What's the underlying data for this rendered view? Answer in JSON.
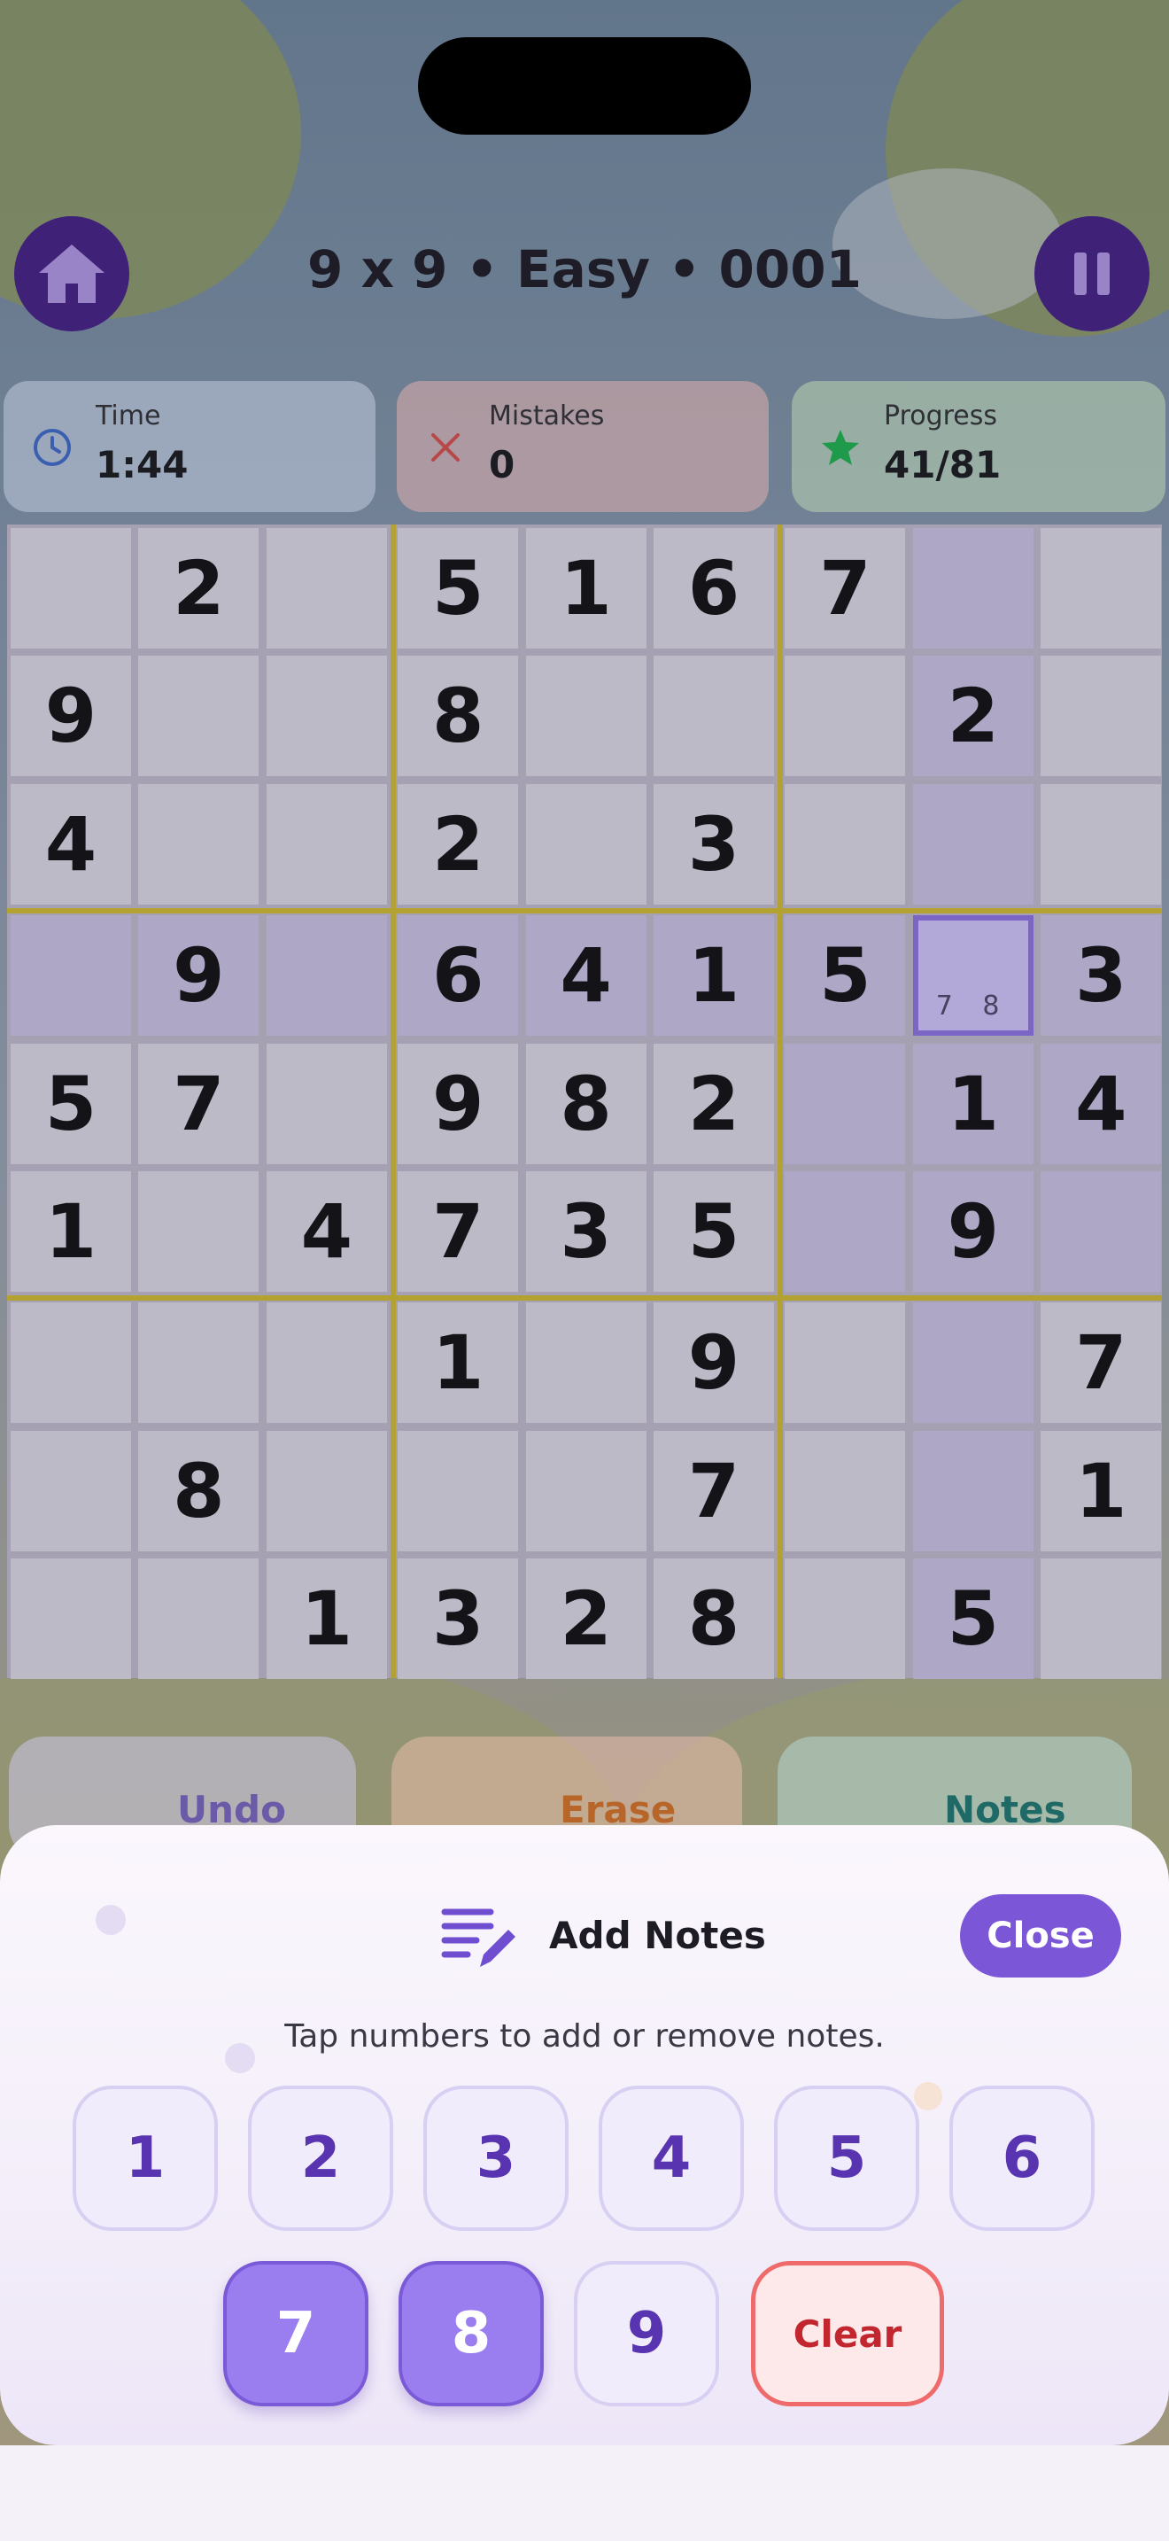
{
  "header": {
    "title": "9 x 9 • Easy • 0001",
    "home_icon": "home-icon",
    "pause_icon": "pause-icon"
  },
  "stats": {
    "time": {
      "label": "Time",
      "value": "1:44",
      "icon": "clock-icon"
    },
    "mistakes": {
      "label": "Mistakes",
      "value": "0",
      "icon": "x-icon"
    },
    "progress": {
      "label": "Progress",
      "value": "41/81",
      "icon": "star-icon"
    }
  },
  "board": {
    "size": 9,
    "rows": [
      [
        "",
        "2",
        "",
        "5",
        "1",
        "6",
        "7",
        "",
        ""
      ],
      [
        "9",
        "",
        "",
        "8",
        "",
        "",
        "",
        "2",
        ""
      ],
      [
        "4",
        "",
        "",
        "2",
        "",
        "3",
        "",
        "",
        ""
      ],
      [
        "",
        "9",
        "",
        "6",
        "4",
        "1",
        "5",
        "",
        "3"
      ],
      [
        "5",
        "7",
        "",
        "9",
        "8",
        "2",
        "",
        "1",
        "4"
      ],
      [
        "1",
        "",
        "4",
        "7",
        "3",
        "5",
        "",
        "9",
        ""
      ],
      [
        "",
        "",
        "",
        "1",
        "",
        "9",
        "",
        "",
        "7"
      ],
      [
        "",
        "8",
        "",
        "",
        "",
        "7",
        "",
        "",
        "1"
      ],
      [
        "",
        "",
        "1",
        "3",
        "2",
        "8",
        "",
        "5",
        ""
      ]
    ],
    "selected": {
      "row": 3,
      "col": 7,
      "notes": "7 8"
    }
  },
  "actions": {
    "undo": "Undo",
    "erase": "Erase",
    "notes": "Notes"
  },
  "notes_sheet": {
    "title": "Add Notes",
    "close_label": "Close",
    "hint": "Tap numbers to add or remove notes.",
    "numbers": [
      {
        "label": "1",
        "active": false
      },
      {
        "label": "2",
        "active": false
      },
      {
        "label": "3",
        "active": false
      },
      {
        "label": "4",
        "active": false
      },
      {
        "label": "5",
        "active": false
      },
      {
        "label": "6",
        "active": false
      },
      {
        "label": "7",
        "active": true
      },
      {
        "label": "8",
        "active": true
      },
      {
        "label": "9",
        "active": false
      }
    ],
    "clear_label": "Clear"
  },
  "colors": {
    "accent": "#7b57d8",
    "dark_purple": "#3f2178",
    "mistake_red": "#c2262e",
    "progress_green": "#1f9a4a",
    "box_line": "#b3a231"
  }
}
